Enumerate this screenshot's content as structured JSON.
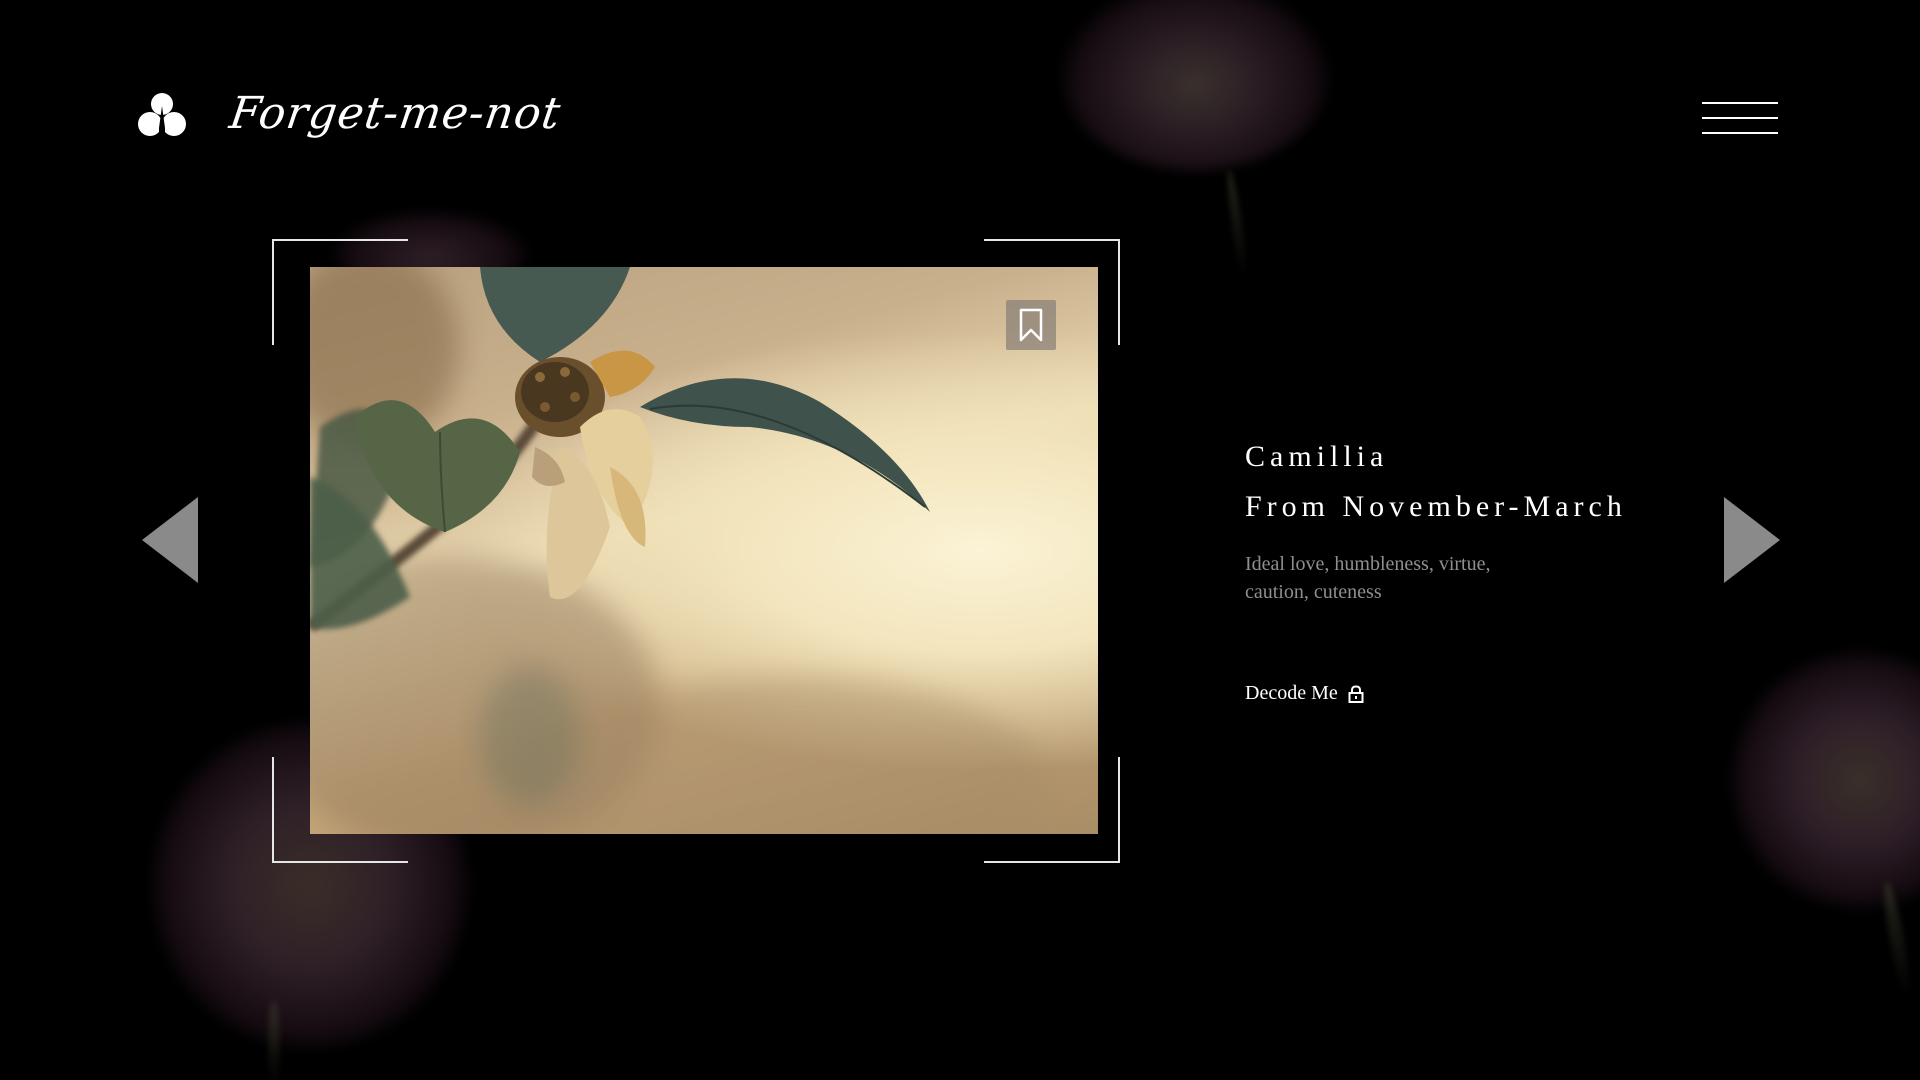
{
  "brand": {
    "name": "Forget-me-not",
    "logo_icon": "flower-logo-icon"
  },
  "header": {
    "menu_icon": "hamburger-menu-icon"
  },
  "carousel": {
    "prev_icon": "triangle-left-icon",
    "next_icon": "triangle-right-icon",
    "image_alt": "dried camellia flower on branch",
    "bookmark_icon": "bookmark-icon"
  },
  "flower": {
    "name": "Camillia",
    "season": "From November-March",
    "meanings_line1": "Ideal love, humbleness, virtue,",
    "meanings_line2": "caution, cuteness",
    "decode_label": "Decode Me",
    "decode_icon": "lock-icon"
  },
  "colors": {
    "background": "#000000",
    "text_primary": "#ffffff",
    "text_muted": "#8f8f8f",
    "arrow": "#8a8a8a",
    "frame": "#e6e6e6"
  }
}
